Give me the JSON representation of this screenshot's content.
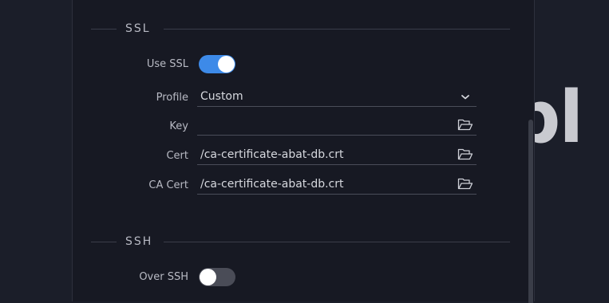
{
  "background": {
    "partial_text": "pl"
  },
  "ssl": {
    "title": "SSL",
    "use_ssl": {
      "label": "Use SSL",
      "enabled": true
    },
    "profile": {
      "label": "Profile",
      "value": "Custom",
      "icon": "chevron-down-icon"
    },
    "key": {
      "label": "Key",
      "value": "",
      "icon": "folder-open-icon"
    },
    "cert": {
      "label": "Cert",
      "value": "/ca-certificate-abat-db.crt",
      "icon": "folder-open-icon"
    },
    "ca_cert": {
      "label": "CA Cert",
      "value": "/ca-certificate-abat-db.crt",
      "icon": "folder-open-icon"
    }
  },
  "ssh": {
    "title": "SSH",
    "over_ssh": {
      "label": "Over SSH",
      "enabled": false
    }
  },
  "colors": {
    "accent": "#3d8ae8",
    "panel": "#171923",
    "background": "#1b1e29"
  }
}
